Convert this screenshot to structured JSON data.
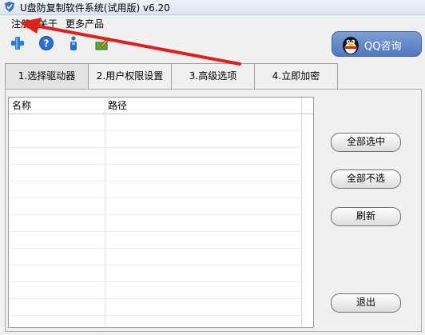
{
  "window": {
    "title": "U盘防复制软件系统(试用版) v6.20"
  },
  "menu": {
    "items": [
      "注册",
      "关于",
      "更多产品"
    ]
  },
  "toolbar": {
    "icons": [
      "add-icon",
      "help-icon",
      "info-icon",
      "edit-icon"
    ]
  },
  "qq_button": {
    "label": "QQ咨询"
  },
  "tabs": [
    {
      "label": "1.选择驱动器",
      "active": true
    },
    {
      "label": "2.用户权限设置",
      "active": false
    },
    {
      "label": "3.高级选项",
      "active": false
    },
    {
      "label": "4.立即加密",
      "active": false
    }
  ],
  "drive_list": {
    "columns": [
      "名称",
      "路径"
    ],
    "rows": []
  },
  "buttons": {
    "select_all": "全部选中",
    "select_none": "全部不选",
    "refresh": "刷新",
    "exit": "退出"
  },
  "colors": {
    "accent_arrow": "#e0201c",
    "qq_button": "#5a82c4",
    "add_icon": "#2b7bd8",
    "help_icon": "#2a6fd6"
  }
}
